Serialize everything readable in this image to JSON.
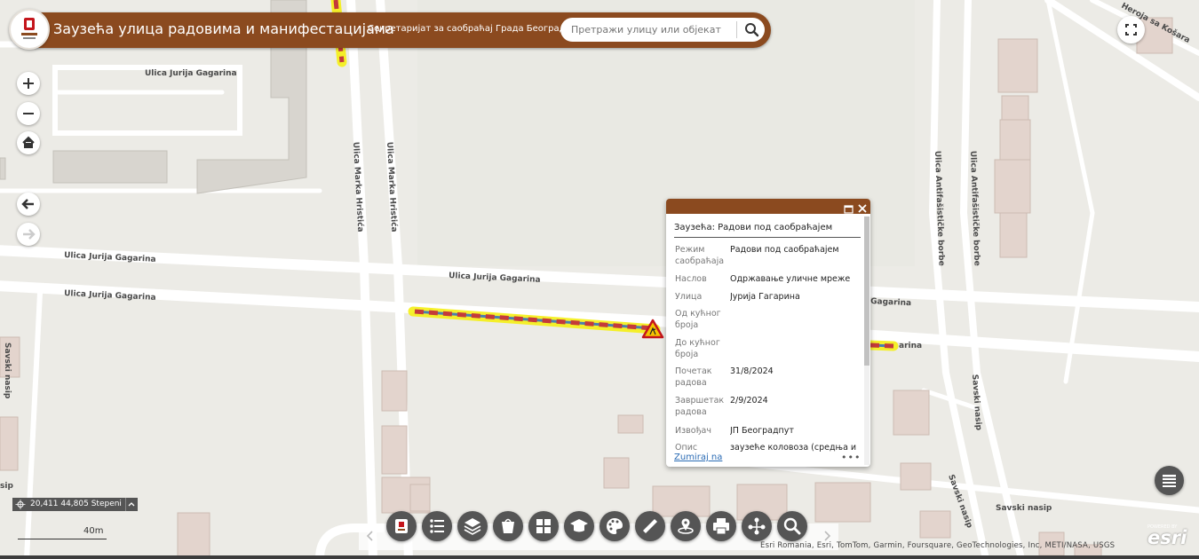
{
  "header": {
    "title": "Заузећа улица радовима и манифестацијама",
    "subtitle": "Секретаријат за саобраћај Града Београда",
    "search_placeholder": "Претражи улицу или објекат"
  },
  "map": {
    "streets": {
      "gagarina": "Ulica Jurija Gagarina",
      "gagarina_right": "Gagarina",
      "marka_hristica": "Ulica Marka Hristića",
      "antifasisticke_borbe": "Ulica Antifašističke borbe",
      "savski_nasip": "Savski nasip",
      "heroja_sa_kosara": "Heroja sa Košara",
      "nasip_short": "sip"
    },
    "colors": {
      "highlight": "#f5f014",
      "dash_a": "#c43a3a",
      "dash_b": "#4a7fb0",
      "brand": "#8b4a1f"
    }
  },
  "popup": {
    "title": "Заузећа: Радови под саобраћајем",
    "rows": [
      {
        "key": "Режим саобраћаја",
        "value": "Радови под саобраћајем"
      },
      {
        "key": "Наслов",
        "value": "Одржавање уличне мреже"
      },
      {
        "key": "Улица",
        "value": "Јурија Гагарина"
      },
      {
        "key": "Од кућног броја",
        "value": ""
      },
      {
        "key": "До кућног броја",
        "value": ""
      },
      {
        "key": "Почетак радова",
        "value": "31/8/2024"
      },
      {
        "key": "Завршетак радова",
        "value": "2/9/2024"
      },
      {
        "key": "Извођач",
        "value": "ЈП Београдпут"
      },
      {
        "key": "Опис",
        "value": "заузеће коловоза (средња и"
      }
    ],
    "zoom_link": "Zumiraj na",
    "more": "•••"
  },
  "coords": {
    "value": "20,411 44,805 Stepeni"
  },
  "scale": {
    "label": "40m"
  },
  "toolbar": {
    "icons": [
      "logo-icon",
      "legend-icon",
      "layers-icon",
      "basemap-icon",
      "widgets-icon",
      "education-icon",
      "palette-icon",
      "measure-icon",
      "location-icon",
      "print-icon",
      "share-icon",
      "search-icon"
    ]
  },
  "attribution": "Esri Romania, Esri, TomTom, Garmin, Foursquare, GeoTechnologies, Inc, METI/NASA, USGS",
  "esri": {
    "powered": "POWERED BY",
    "word": "esri"
  }
}
